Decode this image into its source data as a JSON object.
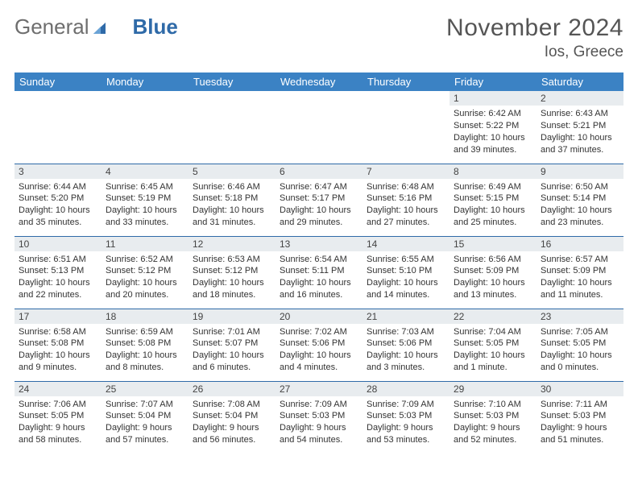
{
  "brand": {
    "part1": "General",
    "part2": "Blue"
  },
  "title": "November 2024",
  "location": "Ios, Greece",
  "weekdays": [
    "Sunday",
    "Monday",
    "Tuesday",
    "Wednesday",
    "Thursday",
    "Friday",
    "Saturday"
  ],
  "weeks": [
    [
      null,
      null,
      null,
      null,
      null,
      {
        "n": "1",
        "sunrise": "Sunrise: 6:42 AM",
        "sunset": "Sunset: 5:22 PM",
        "daylight": "Daylight: 10 hours and 39 minutes."
      },
      {
        "n": "2",
        "sunrise": "Sunrise: 6:43 AM",
        "sunset": "Sunset: 5:21 PM",
        "daylight": "Daylight: 10 hours and 37 minutes."
      }
    ],
    [
      {
        "n": "3",
        "sunrise": "Sunrise: 6:44 AM",
        "sunset": "Sunset: 5:20 PM",
        "daylight": "Daylight: 10 hours and 35 minutes."
      },
      {
        "n": "4",
        "sunrise": "Sunrise: 6:45 AM",
        "sunset": "Sunset: 5:19 PM",
        "daylight": "Daylight: 10 hours and 33 minutes."
      },
      {
        "n": "5",
        "sunrise": "Sunrise: 6:46 AM",
        "sunset": "Sunset: 5:18 PM",
        "daylight": "Daylight: 10 hours and 31 minutes."
      },
      {
        "n": "6",
        "sunrise": "Sunrise: 6:47 AM",
        "sunset": "Sunset: 5:17 PM",
        "daylight": "Daylight: 10 hours and 29 minutes."
      },
      {
        "n": "7",
        "sunrise": "Sunrise: 6:48 AM",
        "sunset": "Sunset: 5:16 PM",
        "daylight": "Daylight: 10 hours and 27 minutes."
      },
      {
        "n": "8",
        "sunrise": "Sunrise: 6:49 AM",
        "sunset": "Sunset: 5:15 PM",
        "daylight": "Daylight: 10 hours and 25 minutes."
      },
      {
        "n": "9",
        "sunrise": "Sunrise: 6:50 AM",
        "sunset": "Sunset: 5:14 PM",
        "daylight": "Daylight: 10 hours and 23 minutes."
      }
    ],
    [
      {
        "n": "10",
        "sunrise": "Sunrise: 6:51 AM",
        "sunset": "Sunset: 5:13 PM",
        "daylight": "Daylight: 10 hours and 22 minutes."
      },
      {
        "n": "11",
        "sunrise": "Sunrise: 6:52 AM",
        "sunset": "Sunset: 5:12 PM",
        "daylight": "Daylight: 10 hours and 20 minutes."
      },
      {
        "n": "12",
        "sunrise": "Sunrise: 6:53 AM",
        "sunset": "Sunset: 5:12 PM",
        "daylight": "Daylight: 10 hours and 18 minutes."
      },
      {
        "n": "13",
        "sunrise": "Sunrise: 6:54 AM",
        "sunset": "Sunset: 5:11 PM",
        "daylight": "Daylight: 10 hours and 16 minutes."
      },
      {
        "n": "14",
        "sunrise": "Sunrise: 6:55 AM",
        "sunset": "Sunset: 5:10 PM",
        "daylight": "Daylight: 10 hours and 14 minutes."
      },
      {
        "n": "15",
        "sunrise": "Sunrise: 6:56 AM",
        "sunset": "Sunset: 5:09 PM",
        "daylight": "Daylight: 10 hours and 13 minutes."
      },
      {
        "n": "16",
        "sunrise": "Sunrise: 6:57 AM",
        "sunset": "Sunset: 5:09 PM",
        "daylight": "Daylight: 10 hours and 11 minutes."
      }
    ],
    [
      {
        "n": "17",
        "sunrise": "Sunrise: 6:58 AM",
        "sunset": "Sunset: 5:08 PM",
        "daylight": "Daylight: 10 hours and 9 minutes."
      },
      {
        "n": "18",
        "sunrise": "Sunrise: 6:59 AM",
        "sunset": "Sunset: 5:08 PM",
        "daylight": "Daylight: 10 hours and 8 minutes."
      },
      {
        "n": "19",
        "sunrise": "Sunrise: 7:01 AM",
        "sunset": "Sunset: 5:07 PM",
        "daylight": "Daylight: 10 hours and 6 minutes."
      },
      {
        "n": "20",
        "sunrise": "Sunrise: 7:02 AM",
        "sunset": "Sunset: 5:06 PM",
        "daylight": "Daylight: 10 hours and 4 minutes."
      },
      {
        "n": "21",
        "sunrise": "Sunrise: 7:03 AM",
        "sunset": "Sunset: 5:06 PM",
        "daylight": "Daylight: 10 hours and 3 minutes."
      },
      {
        "n": "22",
        "sunrise": "Sunrise: 7:04 AM",
        "sunset": "Sunset: 5:05 PM",
        "daylight": "Daylight: 10 hours and 1 minute."
      },
      {
        "n": "23",
        "sunrise": "Sunrise: 7:05 AM",
        "sunset": "Sunset: 5:05 PM",
        "daylight": "Daylight: 10 hours and 0 minutes."
      }
    ],
    [
      {
        "n": "24",
        "sunrise": "Sunrise: 7:06 AM",
        "sunset": "Sunset: 5:05 PM",
        "daylight": "Daylight: 9 hours and 58 minutes."
      },
      {
        "n": "25",
        "sunrise": "Sunrise: 7:07 AM",
        "sunset": "Sunset: 5:04 PM",
        "daylight": "Daylight: 9 hours and 57 minutes."
      },
      {
        "n": "26",
        "sunrise": "Sunrise: 7:08 AM",
        "sunset": "Sunset: 5:04 PM",
        "daylight": "Daylight: 9 hours and 56 minutes."
      },
      {
        "n": "27",
        "sunrise": "Sunrise: 7:09 AM",
        "sunset": "Sunset: 5:03 PM",
        "daylight": "Daylight: 9 hours and 54 minutes."
      },
      {
        "n": "28",
        "sunrise": "Sunrise: 7:09 AM",
        "sunset": "Sunset: 5:03 PM",
        "daylight": "Daylight: 9 hours and 53 minutes."
      },
      {
        "n": "29",
        "sunrise": "Sunrise: 7:10 AM",
        "sunset": "Sunset: 5:03 PM",
        "daylight": "Daylight: 9 hours and 52 minutes."
      },
      {
        "n": "30",
        "sunrise": "Sunrise: 7:11 AM",
        "sunset": "Sunset: 5:03 PM",
        "daylight": "Daylight: 9 hours and 51 minutes."
      }
    ]
  ]
}
